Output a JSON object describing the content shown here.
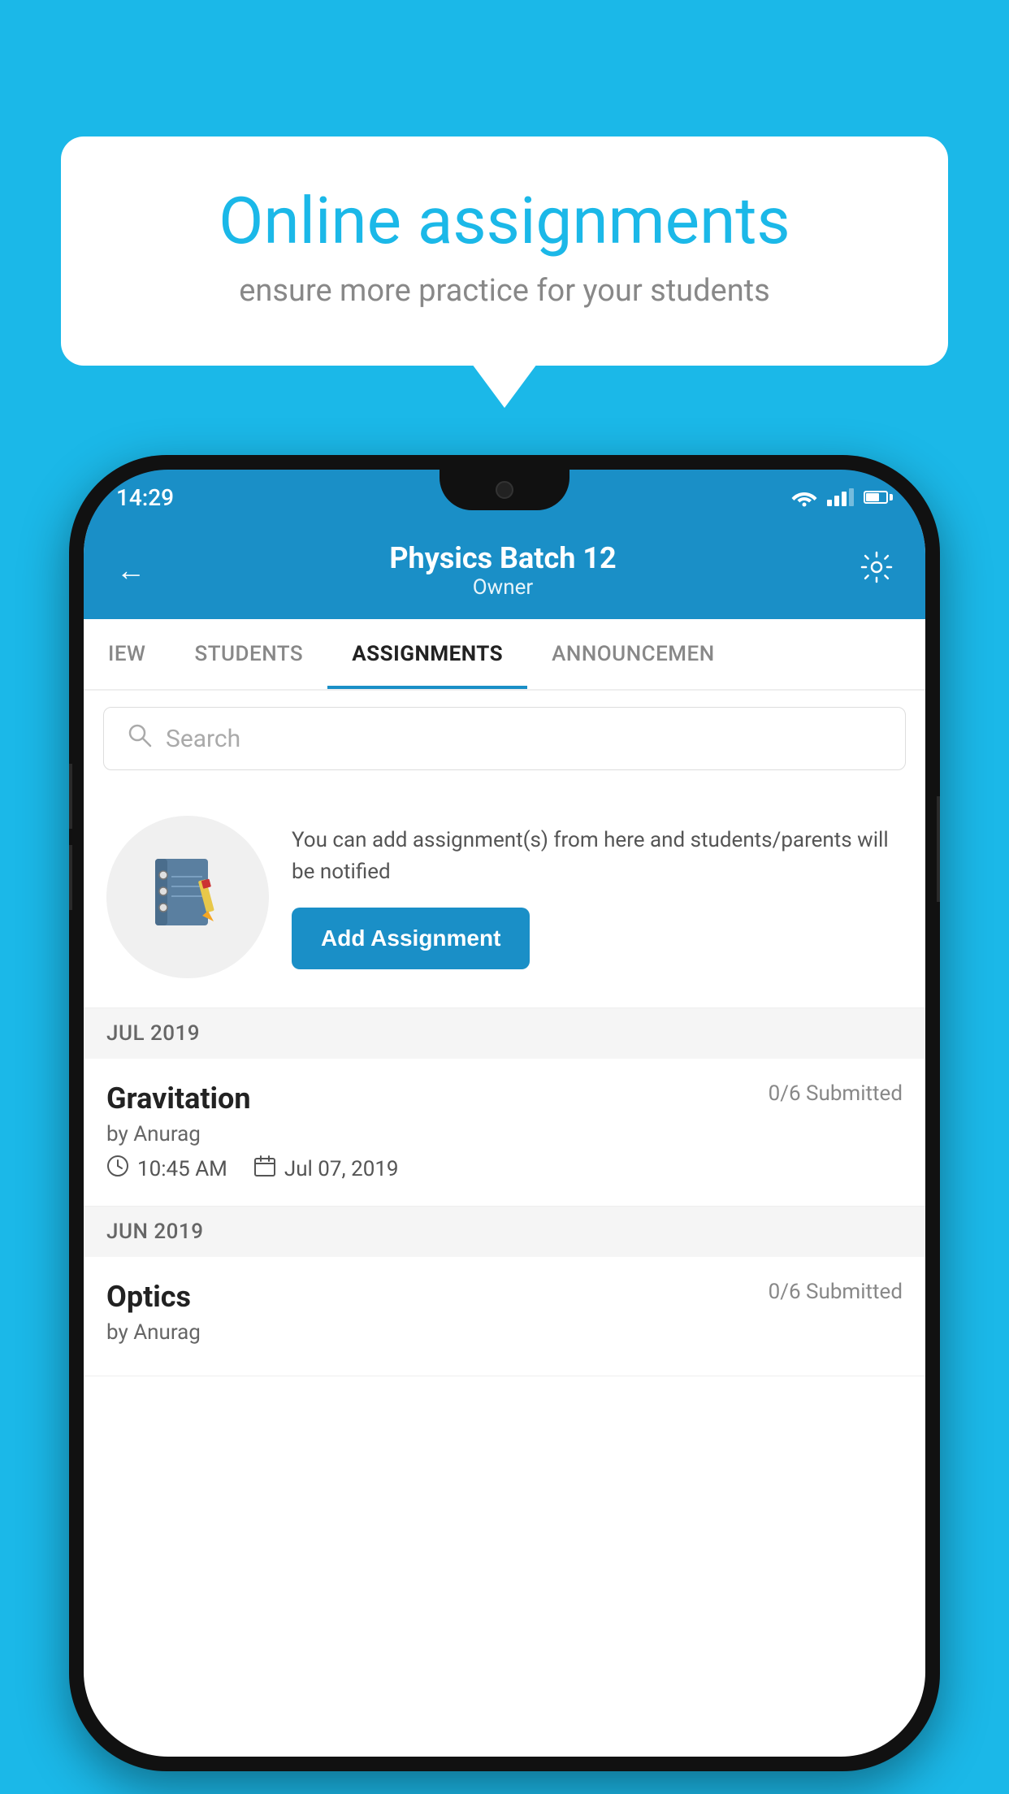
{
  "background_color": "#1bb8e8",
  "speech_bubble": {
    "title": "Online assignments",
    "subtitle": "ensure more practice for your students"
  },
  "phone": {
    "status_bar": {
      "time": "14:29"
    },
    "header": {
      "title": "Physics Batch 12",
      "subtitle": "Owner",
      "back_label": "←",
      "settings_label": "⚙"
    },
    "tabs": [
      {
        "label": "IEW",
        "active": false
      },
      {
        "label": "STUDENTS",
        "active": false
      },
      {
        "label": "ASSIGNMENTS",
        "active": true
      },
      {
        "label": "ANNOUNCEMENTS",
        "active": false
      }
    ],
    "search": {
      "placeholder": "Search"
    },
    "promo": {
      "description": "You can add assignment(s) from here and students/parents will be notified",
      "add_button_label": "Add Assignment"
    },
    "sections": [
      {
        "month": "JUL 2019",
        "assignments": [
          {
            "title": "Gravitation",
            "submitted": "0/6 Submitted",
            "author": "by Anurag",
            "time": "10:45 AM",
            "date": "Jul 07, 2019"
          }
        ]
      },
      {
        "month": "JUN 2019",
        "assignments": [
          {
            "title": "Optics",
            "submitted": "0/6 Submitted",
            "author": "by Anurag",
            "time": "",
            "date": ""
          }
        ]
      }
    ]
  }
}
